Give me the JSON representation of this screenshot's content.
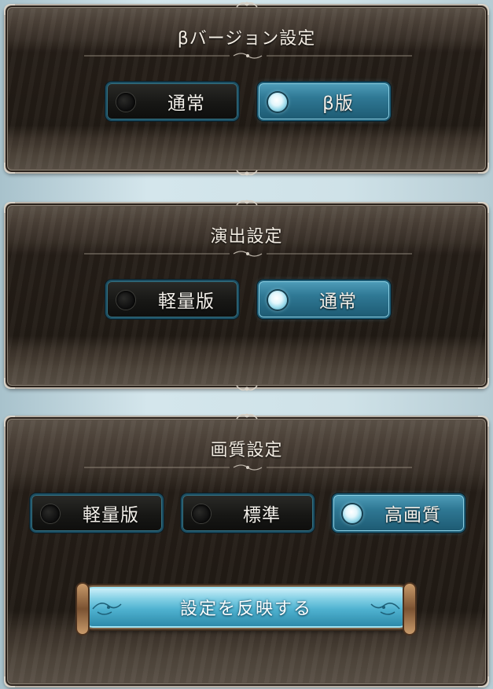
{
  "beta_panel": {
    "title": "βバージョン設定",
    "options": [
      {
        "label": "通常",
        "selected": false
      },
      {
        "label": "β版",
        "selected": true
      }
    ]
  },
  "effects_panel": {
    "title": "演出設定",
    "options": [
      {
        "label": "軽量版",
        "selected": false
      },
      {
        "label": "通常",
        "selected": true
      }
    ]
  },
  "quality_panel": {
    "title": "画質設定",
    "options": [
      {
        "label": "軽量版",
        "selected": false
      },
      {
        "label": "標準",
        "selected": false
      },
      {
        "label": "高画質",
        "selected": true
      }
    ],
    "apply_label": "設定を反映する"
  },
  "colors": {
    "selected_accent": "#2f7894",
    "panel_bg": "#201a14",
    "apply_accent": "#4fb2d0"
  }
}
